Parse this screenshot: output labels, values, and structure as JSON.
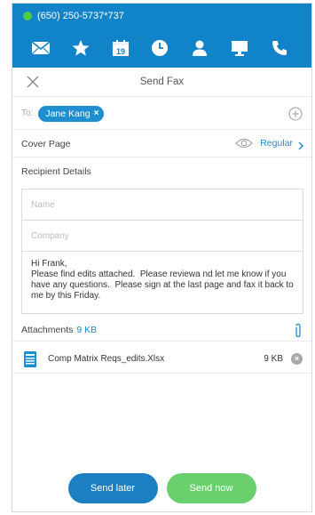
{
  "status": {
    "phone_number": "(650) 250-5737*737"
  },
  "nav": {
    "icons": [
      "mail-icon",
      "star-icon",
      "calendar-icon",
      "clock-icon",
      "contact-icon",
      "computer-icon",
      "phone-icon"
    ],
    "calendar_day": "19"
  },
  "header": {
    "title": "Send Fax"
  },
  "recipient": {
    "to_label": "To:",
    "chip_name": "Jane Kang",
    "chip_remove": "×"
  },
  "cover_page": {
    "label": "Cover Page",
    "value": "Regular"
  },
  "recipient_details": {
    "heading": "Recipient Details",
    "name_placeholder": "Name",
    "company_placeholder": "Company",
    "message": "Hi Frank,\nPlease find edits attached.  Please reviewa nd let me know if you have any questions.  Please sign at the last page and fax it back to me by this Friday."
  },
  "attachments": {
    "label": "Attachments",
    "total_size": "9 KB",
    "files": [
      {
        "name": "Comp Matrix Reqs_edits.Xlsx",
        "size": "9 KB",
        "remove": "×"
      }
    ]
  },
  "actions": {
    "send_later": "Send later",
    "send_now": "Send now"
  },
  "colors": {
    "brand_blue": "#1183c8",
    "chip_blue": "#1e8fd1",
    "send_now_green": "#6ad06d",
    "status_green": "#4fca4a"
  }
}
